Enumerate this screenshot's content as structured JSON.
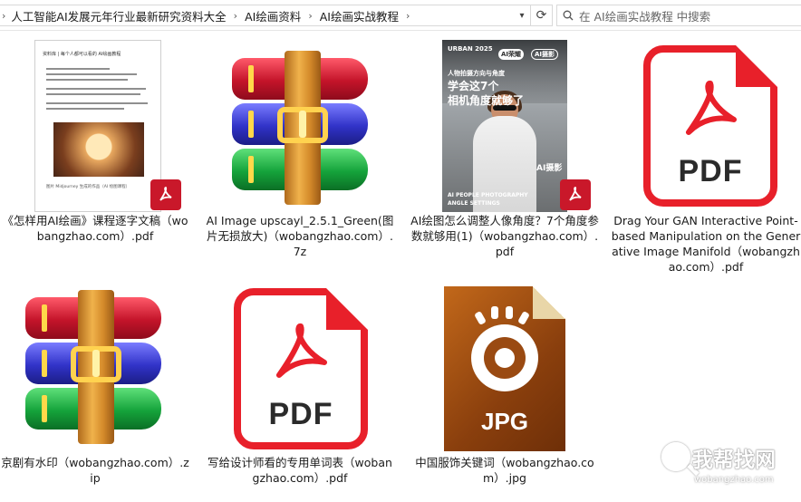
{
  "address_bar": {
    "breadcrumbs": [
      "人工智能AI发展元年行业最新研究资料大全",
      "AI绘画资料",
      "AI绘画实战教程"
    ]
  },
  "search": {
    "placeholder": "在 AI绘画实战教程 中搜索"
  },
  "files": [
    {
      "name": "《怎样用AI绘画》课程逐字文稿（wobangzhao.com）.pdf",
      "kind": "pdf-document-thumb"
    },
    {
      "name": "AI Image upscayl_2.5.1_Green(图片无损放大)（wobangzhao.com）.7z",
      "kind": "archive"
    },
    {
      "name": "AI绘图怎么调整人像角度？7个角度参数就够用(1)（wobangzhao.com）.pdf",
      "kind": "pdf-photo-thumb"
    },
    {
      "name": "Drag Your GAN Interactive Point-based Manipulation on the Generative Image Manifold（wobangzhao.com）.pdf",
      "kind": "pdf-icon"
    },
    {
      "name": "京剧有水印（wobangzhao.com）.zip",
      "kind": "archive"
    },
    {
      "name": "写给设计师看的专用单词表（wobangzhao.com）.pdf",
      "kind": "pdf-icon"
    },
    {
      "name": "中国服饰关键词（wobangzhao.com）.jpg",
      "kind": "jpg"
    }
  ],
  "thumb_text": {
    "pdf_label": "PDF",
    "jpg_label": "JPG",
    "photo_tag": "URBAN 2025",
    "photo_badge1": "AI荣耀",
    "photo_badge2": "AI摄影",
    "photo_line1": "人物拍摄方向与角度",
    "photo_title1": "学会这7个",
    "photo_title2": "相机角度就够了",
    "photo_side": "AI摄影",
    "photo_bottom1": "AI PEOPLE PHOTOGRAPHY",
    "photo_bottom2": "ANGLE SETTINGS",
    "doc_title": "资料库 | 每个人都可以看的 AI绘画教程",
    "doc_caption": "图片 Midjourney 生成的作品（AI 绘图课程）"
  },
  "watermark": {
    "title": "我帮找网",
    "url": "wobangzhao.com"
  },
  "colors": {
    "pdf_red": "#e8202a",
    "accent": "#c9182a"
  }
}
